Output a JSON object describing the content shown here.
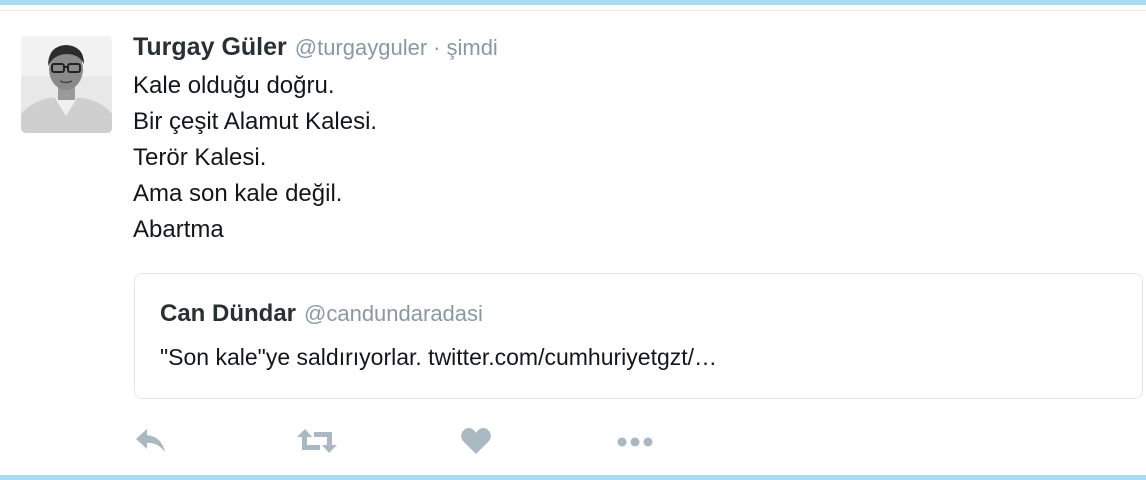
{
  "tweet": {
    "author_name": "Turgay Güler",
    "author_handle": "@turgayguler",
    "separator": "·",
    "timestamp": "şimdi",
    "lines": [
      "Kale olduğu doğru.",
      "Bir çeşit Alamut Kalesi.",
      "Terör Kalesi.",
      "Ama son kale değil.",
      "Abartma"
    ]
  },
  "quoted_tweet": {
    "author_name": "Can Dündar",
    "author_handle": "@candundaradasi",
    "text": "\"Son kale\"ye saldırıyorlar. twitter.com/cumhuriyetgzt/…"
  },
  "actions": [
    {
      "icon": "reply-icon"
    },
    {
      "icon": "retweet-icon"
    },
    {
      "icon": "heart-icon"
    },
    {
      "icon": "more-icon"
    }
  ],
  "colors": {
    "border_accent": "#a9dcf3",
    "secondary_text": "#8899a6",
    "icon": "#aab8c2"
  }
}
